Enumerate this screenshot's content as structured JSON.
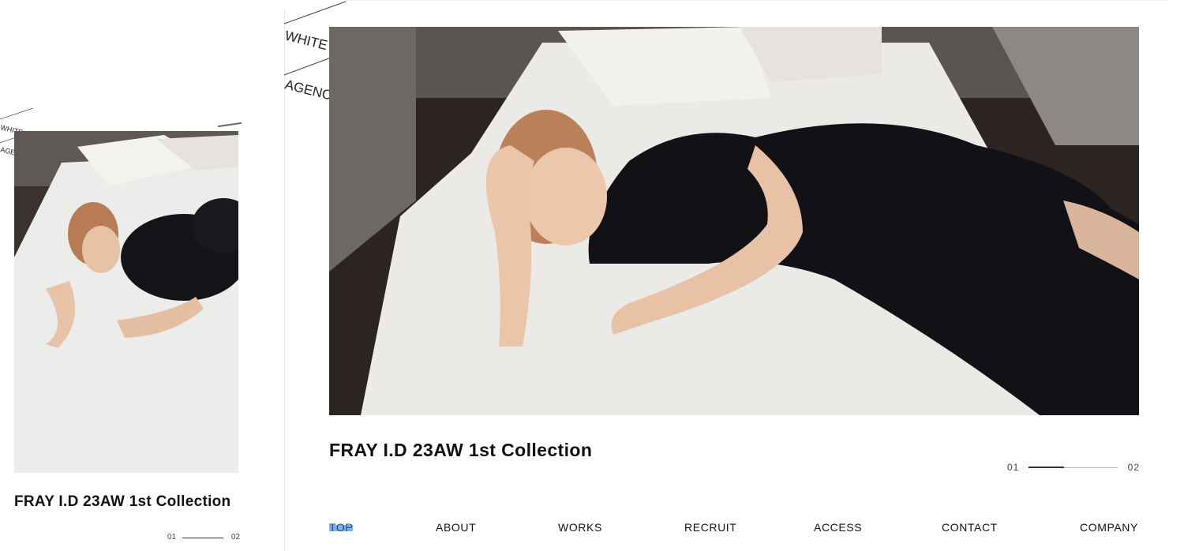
{
  "brand": {
    "line1": "WHITE",
    "line2": "AGENCY"
  },
  "mobile": {
    "title": "FRAY I.D 23AW 1st Collection",
    "pager": {
      "current": "01",
      "total": "02"
    }
  },
  "desktop": {
    "title": "FRAY I.D 23AW 1st Collection",
    "pager": {
      "current": "01",
      "total": "02",
      "progress": 0.4
    },
    "nav": [
      {
        "label": "TOP",
        "active": true
      },
      {
        "label": "ABOUT",
        "active": false
      },
      {
        "label": "WORKS",
        "active": false
      },
      {
        "label": "RECRUIT",
        "active": false
      },
      {
        "label": "ACCESS",
        "active": false
      },
      {
        "label": "CONTACT",
        "active": false
      },
      {
        "label": "COMPANY",
        "active": false
      }
    ]
  },
  "colors": {
    "nav_active_highlight": "#7fb1e8",
    "text": "#111111"
  }
}
